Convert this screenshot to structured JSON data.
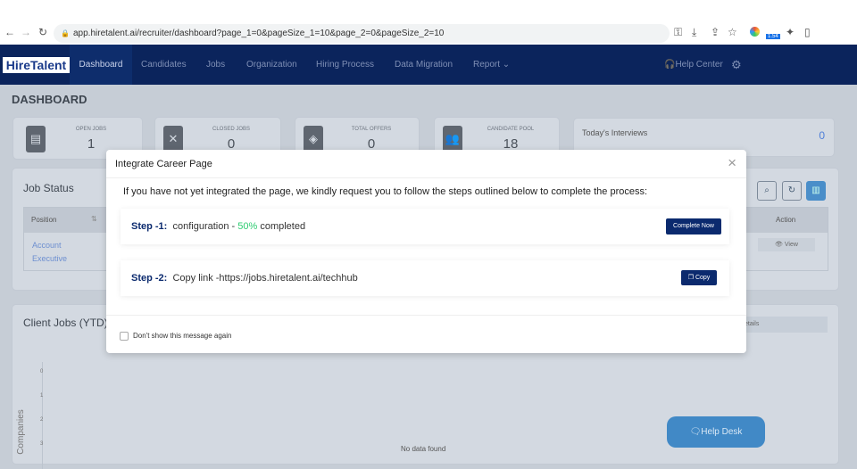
{
  "browser": {
    "url": "app.hiretalent.ai/recruiter/dashboard?page_1=0&pageSize_1=10&page_2=0&pageSize_2=10",
    "badge": "1.54"
  },
  "nav": {
    "logo": "HireTalent",
    "items": [
      "Dashboard",
      "Candidates",
      "Jobs",
      "Organization",
      "Hiring Process",
      "Data Migration",
      "Report ⌄"
    ],
    "help": "Help Center"
  },
  "page_title": "DASHBOARD",
  "cards": [
    {
      "label": "OPEN JOBS",
      "value": "1"
    },
    {
      "label": "CLOSED JOBS",
      "value": "0"
    },
    {
      "label": "TOTAL OFFERS",
      "value": "0"
    },
    {
      "label": "CANDIDATE POOL",
      "value": "18"
    }
  ],
  "interviews": {
    "label": "Today's Interviews",
    "value": "0"
  },
  "job_status": {
    "title": "Job Status",
    "col_position": "Position",
    "col_action": "Action",
    "row_position": "Account Executive",
    "row_action": "View"
  },
  "client_jobs": {
    "title": "Client Jobs (YTD)",
    "details": "etails",
    "ylabel": "Companies",
    "ticks": [
      "0",
      "1",
      "2",
      "3"
    ],
    "empty": "No data found"
  },
  "modal": {
    "title": "Integrate Career Page",
    "intro": "If you have not yet integrated the page, we kindly request you to follow the steps outlined below to complete the process:",
    "step1_label": "Step -1:",
    "step1_text": "configuration - ",
    "step1_pct": "50%",
    "step1_tail": " completed",
    "step1_button": "Complete Now",
    "step2_label": "Step -2:",
    "step2_text": "Copy link -https://jobs.hiretalent.ai/techhub",
    "step2_button": "Copy",
    "checkbox": "Don't show this message again"
  },
  "help_desk": "Help Desk",
  "colors": {
    "navy": "#0b2a6e",
    "green": "#2ecc71"
  }
}
